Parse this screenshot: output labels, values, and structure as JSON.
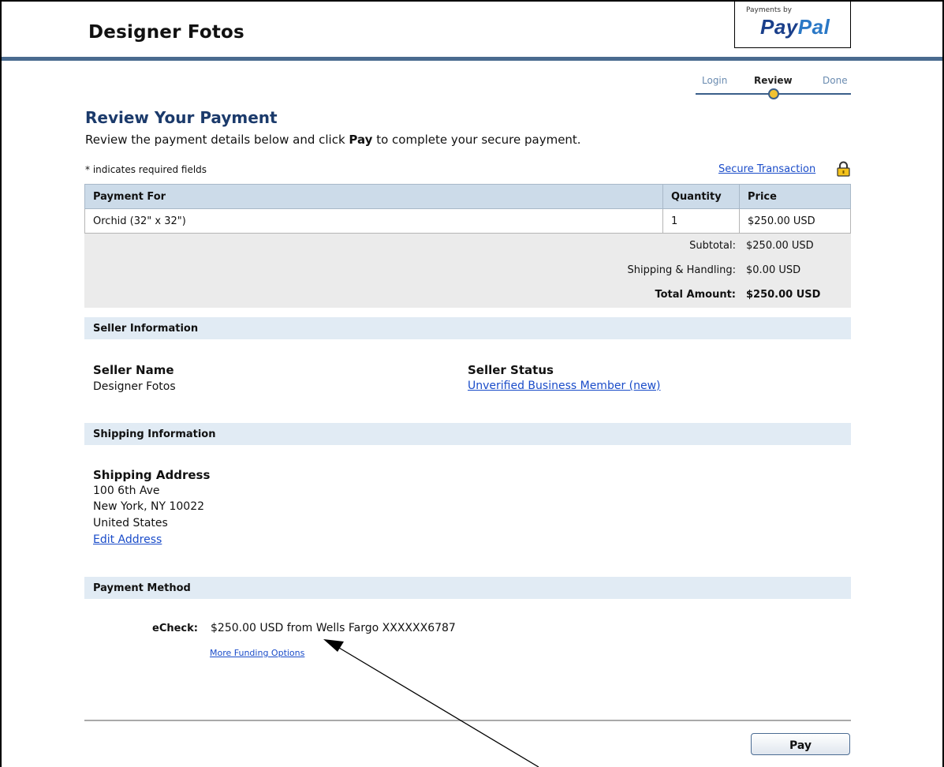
{
  "header": {
    "merchant_name": "Designer Fotos",
    "badge_small": "Payments by",
    "badge_brand_a": "Pay",
    "badge_brand_b": "Pal"
  },
  "steps": [
    "Login",
    "Review",
    "Done"
  ],
  "active_step": "Review",
  "page": {
    "title": "Review Your Payment",
    "intro_before": "Review the payment details below and click ",
    "intro_bold": "Pay",
    "intro_after": " to complete your secure payment.",
    "required_note": "* indicates required fields",
    "secure_link": "Secure Transaction"
  },
  "items_table": {
    "headers": [
      "Payment For",
      "Quantity",
      "Price"
    ],
    "rows": [
      [
        "Orchid (32\" x 32\")",
        "1",
        "$250.00 USD"
      ]
    ]
  },
  "summary": {
    "subtotal_label": "Subtotal:",
    "subtotal_value": "$250.00 USD",
    "shipping_label": "Shipping & Handling:",
    "shipping_value": "$0.00 USD",
    "total_label": "Total Amount:",
    "total_value": "$250.00 USD"
  },
  "seller": {
    "section_title": "Seller Information",
    "name_label": "Seller Name",
    "name_value": "Designer Fotos",
    "status_label": "Seller Status",
    "status_value": "Unverified Business Member (new)"
  },
  "shipping": {
    "section_title": "Shipping Information",
    "address_label": "Shipping Address",
    "line1": "100 6th Ave",
    "line2": "New York, NY 10022",
    "line3": "United States",
    "edit_link": "Edit Address"
  },
  "payment_method": {
    "section_title": "Payment Method",
    "type_label": "eCheck:",
    "detail": "$250.00 USD from Wells Fargo XXXXXX6787",
    "more_link": "More Funding Options"
  },
  "actions": {
    "pay_label": "Pay"
  },
  "colors": {
    "header_bar": "#4a6b8f",
    "title_blue": "#1b3a6b",
    "link_blue": "#1a4cc9",
    "table_header": "#ccdbe9",
    "section_bar": "#e1ebf4"
  }
}
